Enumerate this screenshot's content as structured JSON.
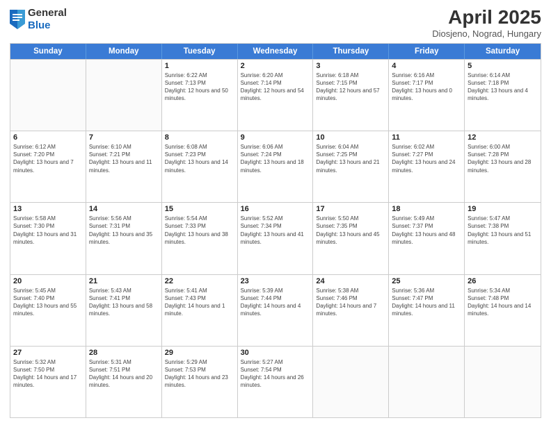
{
  "header": {
    "logo": {
      "general": "General",
      "blue": "Blue"
    },
    "title": "April 2025",
    "subtitle": "Diosjeno, Nograd, Hungary"
  },
  "days": [
    "Sunday",
    "Monday",
    "Tuesday",
    "Wednesday",
    "Thursday",
    "Friday",
    "Saturday"
  ],
  "weeks": [
    [
      {
        "date": "",
        "sunrise": "",
        "sunset": "",
        "daylight": ""
      },
      {
        "date": "",
        "sunrise": "",
        "sunset": "",
        "daylight": ""
      },
      {
        "date": "1",
        "sunrise": "Sunrise: 6:22 AM",
        "sunset": "Sunset: 7:13 PM",
        "daylight": "Daylight: 12 hours and 50 minutes."
      },
      {
        "date": "2",
        "sunrise": "Sunrise: 6:20 AM",
        "sunset": "Sunset: 7:14 PM",
        "daylight": "Daylight: 12 hours and 54 minutes."
      },
      {
        "date": "3",
        "sunrise": "Sunrise: 6:18 AM",
        "sunset": "Sunset: 7:15 PM",
        "daylight": "Daylight: 12 hours and 57 minutes."
      },
      {
        "date": "4",
        "sunrise": "Sunrise: 6:16 AM",
        "sunset": "Sunset: 7:17 PM",
        "daylight": "Daylight: 13 hours and 0 minutes."
      },
      {
        "date": "5",
        "sunrise": "Sunrise: 6:14 AM",
        "sunset": "Sunset: 7:18 PM",
        "daylight": "Daylight: 13 hours and 4 minutes."
      }
    ],
    [
      {
        "date": "6",
        "sunrise": "Sunrise: 6:12 AM",
        "sunset": "Sunset: 7:20 PM",
        "daylight": "Daylight: 13 hours and 7 minutes."
      },
      {
        "date": "7",
        "sunrise": "Sunrise: 6:10 AM",
        "sunset": "Sunset: 7:21 PM",
        "daylight": "Daylight: 13 hours and 11 minutes."
      },
      {
        "date": "8",
        "sunrise": "Sunrise: 6:08 AM",
        "sunset": "Sunset: 7:23 PM",
        "daylight": "Daylight: 13 hours and 14 minutes."
      },
      {
        "date": "9",
        "sunrise": "Sunrise: 6:06 AM",
        "sunset": "Sunset: 7:24 PM",
        "daylight": "Daylight: 13 hours and 18 minutes."
      },
      {
        "date": "10",
        "sunrise": "Sunrise: 6:04 AM",
        "sunset": "Sunset: 7:25 PM",
        "daylight": "Daylight: 13 hours and 21 minutes."
      },
      {
        "date": "11",
        "sunrise": "Sunrise: 6:02 AM",
        "sunset": "Sunset: 7:27 PM",
        "daylight": "Daylight: 13 hours and 24 minutes."
      },
      {
        "date": "12",
        "sunrise": "Sunrise: 6:00 AM",
        "sunset": "Sunset: 7:28 PM",
        "daylight": "Daylight: 13 hours and 28 minutes."
      }
    ],
    [
      {
        "date": "13",
        "sunrise": "Sunrise: 5:58 AM",
        "sunset": "Sunset: 7:30 PM",
        "daylight": "Daylight: 13 hours and 31 minutes."
      },
      {
        "date": "14",
        "sunrise": "Sunrise: 5:56 AM",
        "sunset": "Sunset: 7:31 PM",
        "daylight": "Daylight: 13 hours and 35 minutes."
      },
      {
        "date": "15",
        "sunrise": "Sunrise: 5:54 AM",
        "sunset": "Sunset: 7:33 PM",
        "daylight": "Daylight: 13 hours and 38 minutes."
      },
      {
        "date": "16",
        "sunrise": "Sunrise: 5:52 AM",
        "sunset": "Sunset: 7:34 PM",
        "daylight": "Daylight: 13 hours and 41 minutes."
      },
      {
        "date": "17",
        "sunrise": "Sunrise: 5:50 AM",
        "sunset": "Sunset: 7:35 PM",
        "daylight": "Daylight: 13 hours and 45 minutes."
      },
      {
        "date": "18",
        "sunrise": "Sunrise: 5:49 AM",
        "sunset": "Sunset: 7:37 PM",
        "daylight": "Daylight: 13 hours and 48 minutes."
      },
      {
        "date": "19",
        "sunrise": "Sunrise: 5:47 AM",
        "sunset": "Sunset: 7:38 PM",
        "daylight": "Daylight: 13 hours and 51 minutes."
      }
    ],
    [
      {
        "date": "20",
        "sunrise": "Sunrise: 5:45 AM",
        "sunset": "Sunset: 7:40 PM",
        "daylight": "Daylight: 13 hours and 55 minutes."
      },
      {
        "date": "21",
        "sunrise": "Sunrise: 5:43 AM",
        "sunset": "Sunset: 7:41 PM",
        "daylight": "Daylight: 13 hours and 58 minutes."
      },
      {
        "date": "22",
        "sunrise": "Sunrise: 5:41 AM",
        "sunset": "Sunset: 7:43 PM",
        "daylight": "Daylight: 14 hours and 1 minute."
      },
      {
        "date": "23",
        "sunrise": "Sunrise: 5:39 AM",
        "sunset": "Sunset: 7:44 PM",
        "daylight": "Daylight: 14 hours and 4 minutes."
      },
      {
        "date": "24",
        "sunrise": "Sunrise: 5:38 AM",
        "sunset": "Sunset: 7:46 PM",
        "daylight": "Daylight: 14 hours and 7 minutes."
      },
      {
        "date": "25",
        "sunrise": "Sunrise: 5:36 AM",
        "sunset": "Sunset: 7:47 PM",
        "daylight": "Daylight: 14 hours and 11 minutes."
      },
      {
        "date": "26",
        "sunrise": "Sunrise: 5:34 AM",
        "sunset": "Sunset: 7:48 PM",
        "daylight": "Daylight: 14 hours and 14 minutes."
      }
    ],
    [
      {
        "date": "27",
        "sunrise": "Sunrise: 5:32 AM",
        "sunset": "Sunset: 7:50 PM",
        "daylight": "Daylight: 14 hours and 17 minutes."
      },
      {
        "date": "28",
        "sunrise": "Sunrise: 5:31 AM",
        "sunset": "Sunset: 7:51 PM",
        "daylight": "Daylight: 14 hours and 20 minutes."
      },
      {
        "date": "29",
        "sunrise": "Sunrise: 5:29 AM",
        "sunset": "Sunset: 7:53 PM",
        "daylight": "Daylight: 14 hours and 23 minutes."
      },
      {
        "date": "30",
        "sunrise": "Sunrise: 5:27 AM",
        "sunset": "Sunset: 7:54 PM",
        "daylight": "Daylight: 14 hours and 26 minutes."
      },
      {
        "date": "",
        "sunrise": "",
        "sunset": "",
        "daylight": ""
      },
      {
        "date": "",
        "sunrise": "",
        "sunset": "",
        "daylight": ""
      },
      {
        "date": "",
        "sunrise": "",
        "sunset": "",
        "daylight": ""
      }
    ]
  ]
}
